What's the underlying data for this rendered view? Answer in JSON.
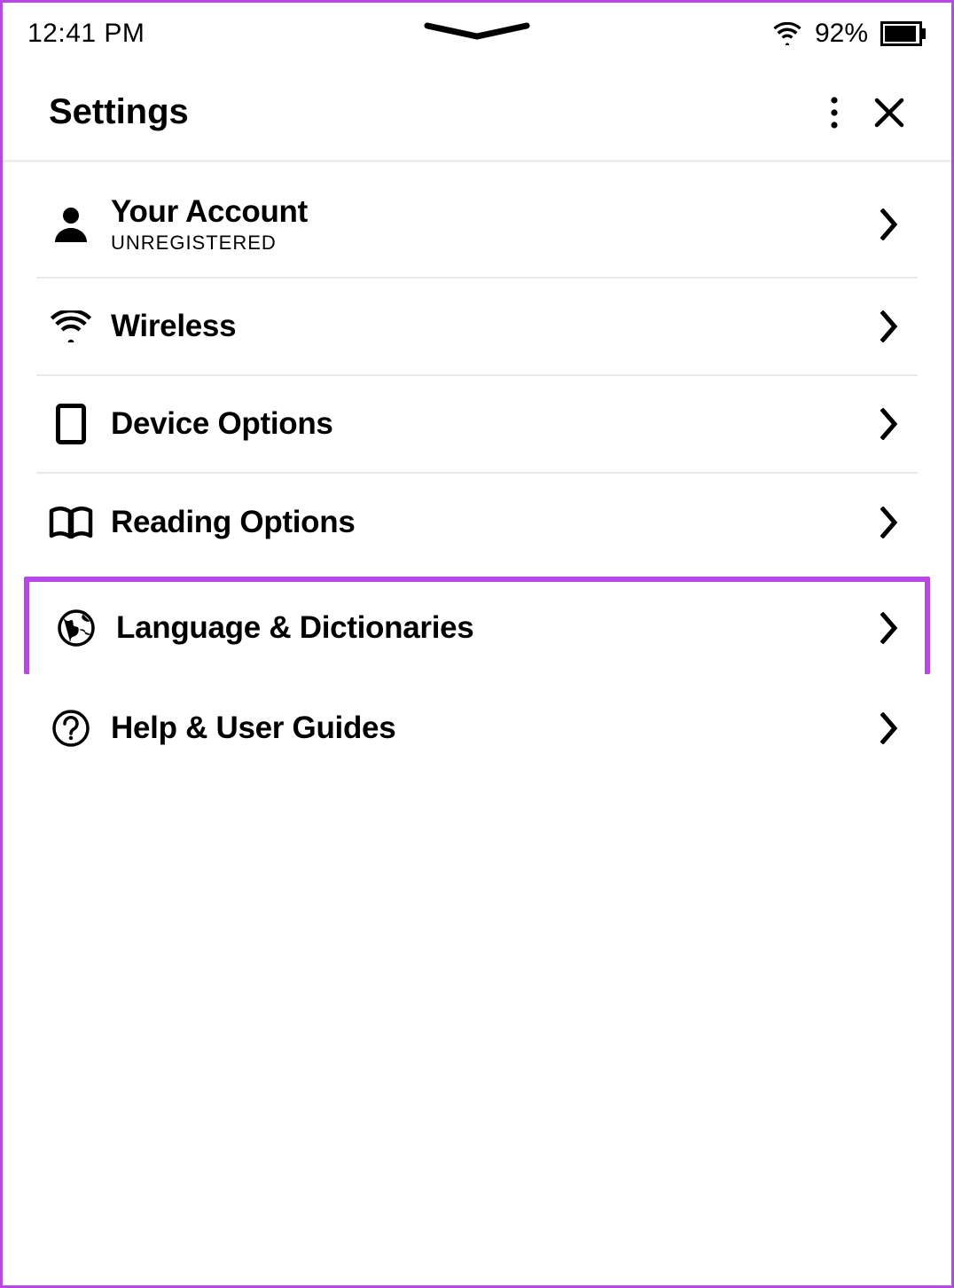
{
  "status": {
    "time": "12:41 PM",
    "battery_percent": "92%"
  },
  "header": {
    "title": "Settings"
  },
  "items": {
    "account": {
      "title": "Your Account",
      "sub": "UNREGISTERED"
    },
    "wireless": {
      "title": "Wireless"
    },
    "device": {
      "title": "Device Options"
    },
    "reading": {
      "title": "Reading Options"
    },
    "language": {
      "title": "Language & Dictionaries"
    },
    "help": {
      "title": "Help & User Guides"
    }
  }
}
